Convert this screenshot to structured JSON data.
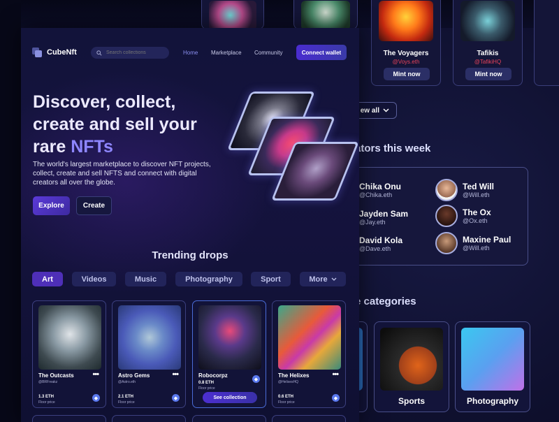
{
  "back_page": {
    "cards": [
      {
        "title": "The Voyagers",
        "handle": "@Voys.eth",
        "button": "Mint now"
      },
      {
        "title": "Tafikis",
        "handle": "@TafikiHQ",
        "button": "Mint now"
      }
    ],
    "view_all": "ew all",
    "creators_heading": "ators this week",
    "creators": [
      {
        "name": "Chika Onu",
        "handle": "@Chika.eth"
      },
      {
        "name": "Ted Will",
        "handle": "@Will.eth"
      },
      {
        "name": "Jayden Sam",
        "handle": "@Jay.eth"
      },
      {
        "name": "The Ox",
        "handle": "@Ox.eth"
      },
      {
        "name": "David Kola",
        "handle": "@Dave.eth"
      },
      {
        "name": "Maxine Paul",
        "handle": "@Will.eth"
      }
    ],
    "categories_heading": "e categories",
    "categories": [
      "Sports",
      "Photography"
    ]
  },
  "header": {
    "logo": "CubeNft",
    "search_placeholder": "Search collections",
    "nav": [
      "Home",
      "Marketplace",
      "Community"
    ],
    "connect": "Connect wallet"
  },
  "hero": {
    "line1": "Discover, collect,",
    "line2": "create and sell your",
    "line3_a": "rare ",
    "line3_b": "NFTs",
    "subtitle": "The world's largest marketplace to discover NFT projects, collect, create and sell NFTS and connect with digital creators all over the globe.",
    "explore": "Explore",
    "create": "Create"
  },
  "trending": {
    "heading": "Trending drops",
    "tabs": [
      "Art",
      "Videos",
      "Music",
      "Photography",
      "Sport",
      "More"
    ],
    "cards": [
      {
        "name": "The Outcasts",
        "handle": "@BRFreakz",
        "price": "1.3 ETH",
        "floor": "Floor price"
      },
      {
        "name": "Astro Gems",
        "handle": "@Astro.eth",
        "price": "2.1 ETH",
        "floor": "Floor price"
      },
      {
        "name": "Robocorpz",
        "handle": "",
        "price": "0.8 ETH",
        "floor": "Floor price",
        "button": "See collection"
      },
      {
        "name": "The Helixes",
        "handle": "@HelixesHQ",
        "price": "0.6 ETH",
        "floor": "Floor price"
      }
    ]
  },
  "colors": {
    "accent": "#4e2fb8",
    "nft_text": "#8e86ff",
    "background": "#0b0c26"
  },
  "icons": [
    "search-icon",
    "ethereum-icon",
    "chevron-down-icon",
    "more-dots-icon"
  ]
}
